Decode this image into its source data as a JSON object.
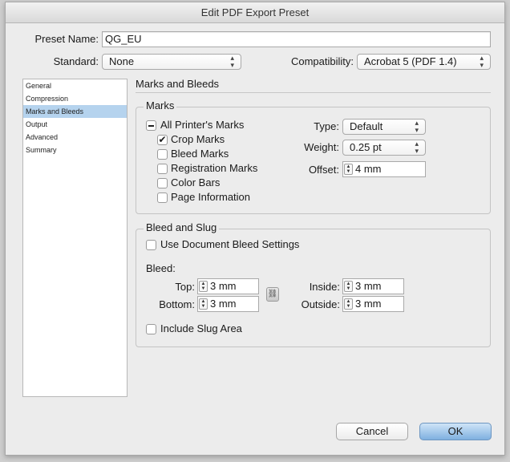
{
  "window": {
    "title": "Edit PDF Export Preset"
  },
  "preset": {
    "label": "Preset Name:",
    "value": "QG_EU"
  },
  "standard": {
    "label": "Standard:",
    "value": "None"
  },
  "compatibility": {
    "label": "Compatibility:",
    "value": "Acrobat 5 (PDF 1.4)"
  },
  "sidebar": {
    "items": [
      {
        "label": "General",
        "selected": false
      },
      {
        "label": "Compression",
        "selected": false
      },
      {
        "label": "Marks and Bleeds",
        "selected": true
      },
      {
        "label": "Output",
        "selected": false
      },
      {
        "label": "Advanced",
        "selected": false
      },
      {
        "label": "Summary",
        "selected": false
      }
    ]
  },
  "panel": {
    "title": "Marks and Bleeds"
  },
  "marks": {
    "group_title": "Marks",
    "all_printers_marks": {
      "label": "All Printer's Marks",
      "state": "mixed"
    },
    "crop_marks": {
      "label": "Crop Marks",
      "checked": true
    },
    "bleed_marks": {
      "label": "Bleed Marks",
      "checked": false
    },
    "registration_marks": {
      "label": "Registration Marks",
      "checked": false
    },
    "color_bars": {
      "label": "Color Bars",
      "checked": false
    },
    "page_information": {
      "label": "Page Information",
      "checked": false
    },
    "type": {
      "label": "Type:",
      "value": "Default"
    },
    "weight": {
      "label": "Weight:",
      "value": "0.25 pt"
    },
    "offset": {
      "label": "Offset:",
      "value": "4 mm"
    }
  },
  "bleed": {
    "group_title": "Bleed and Slug",
    "use_document": {
      "label": "Use Document Bleed Settings",
      "checked": false
    },
    "bleed_label": "Bleed:",
    "top": {
      "label": "Top:",
      "value": "3 mm"
    },
    "bottom": {
      "label": "Bottom:",
      "value": "3 mm"
    },
    "inside": {
      "label": "Inside:",
      "value": "3 mm"
    },
    "outside": {
      "label": "Outside:",
      "value": "3 mm"
    },
    "include_slug": {
      "label": "Include Slug Area",
      "checked": false
    }
  },
  "buttons": {
    "cancel": "Cancel",
    "ok": "OK"
  },
  "icons": {
    "stepper": "stepper-arrows-icon",
    "popup": "popup-arrows-icon",
    "chain": "chain-link-icon",
    "check": "checkmark-icon"
  },
  "colors": {
    "selection": "#b5d3ee",
    "default_button": "#7fb0e0",
    "window_bg": "#ececec"
  }
}
